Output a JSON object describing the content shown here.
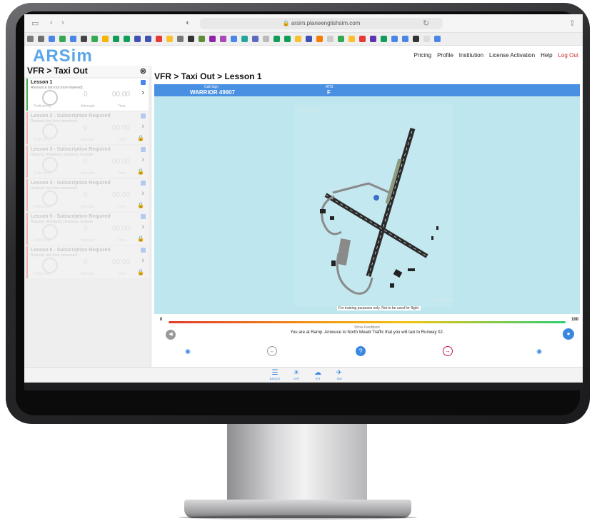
{
  "browser": {
    "url": "arsim.planeenglishsim.com"
  },
  "app": {
    "logo": "ARSim"
  },
  "nav": [
    "Pricing",
    "Profile",
    "Institution",
    "License Activation",
    "Help",
    "Log Out"
  ],
  "sidebar": {
    "title": "VFR > Taxi Out",
    "lessons": [
      {
        "title": "Lesson 1",
        "subtitle": "Announce taxi out (non-towered).",
        "attempt": "0",
        "time": "00:00",
        "caps": [
          "Proficiency",
          "Attempts",
          "Time"
        ],
        "locked": false
      },
      {
        "title": "Lesson 2 - Subscription Required",
        "subtitle": "Request, taxi from movement",
        "attempt": "0",
        "time": "00:00",
        "caps": [
          "Proficiency",
          "Attempts",
          "Time"
        ],
        "locked": true
      },
      {
        "title": "Lesson 3 - Subscription Required",
        "subtitle": "Request, Readback clearance, Activate",
        "attempt": "0",
        "time": "00:00",
        "caps": [
          "Proficiency",
          "Attempts",
          "Time"
        ],
        "locked": true
      },
      {
        "title": "Lesson 4 - Subscription Required",
        "subtitle": "Request, taxi from movement",
        "attempt": "0",
        "time": "00:00",
        "caps": [
          "Proficiency",
          "Attempts",
          "Time"
        ],
        "locked": true
      },
      {
        "title": "Lesson 5 - Subscription Required",
        "subtitle": "Request, Readback clearance, Activate",
        "attempt": "0",
        "time": "00:00",
        "caps": [
          "Proficiency",
          "Attempts",
          "Time"
        ],
        "locked": true
      },
      {
        "title": "Lesson 6 - Subscription Required",
        "subtitle": "Request, taxi from movement",
        "attempt": "0",
        "time": "00:00",
        "caps": [
          "Proficiency",
          "Attempts",
          "Time"
        ],
        "locked": true
      }
    ]
  },
  "main": {
    "breadcrumb": "VFR > Taxi Out > Lesson 1",
    "call_sign_label": "Call Sign",
    "call_sign": "WARRIOR 49907",
    "atis_label": "ATIS",
    "atis": "F",
    "map_watermark": "PlaneEnglish",
    "disclaimer": "For training purposes only. Not to be used for flight.",
    "bar_min": "0",
    "bar_max": "100",
    "show_feedback": "Show Feedback",
    "instruction": "You are at Ramp. Annouce to North Weald Traffic that you will taxi to Runway 02."
  },
  "tabs": [
    "BASICS",
    "VFR",
    "IFR",
    "SIM"
  ],
  "colors": {
    "accent": "#4a90e2",
    "logout": "#d12a2a",
    "map": "#bde6ee",
    "logo": "#5aa6e8"
  }
}
